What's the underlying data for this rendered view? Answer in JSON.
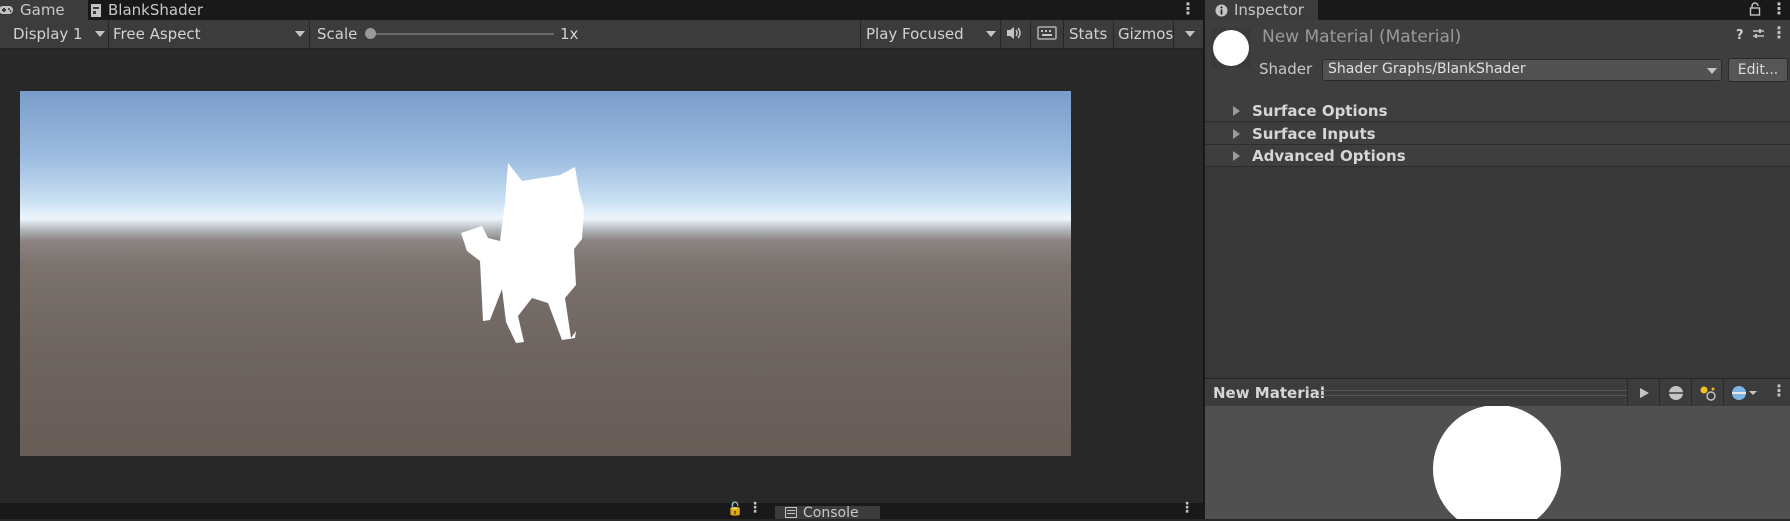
{
  "game_panel": {
    "tabs": [
      {
        "label": "Game",
        "icon": "gamepad-icon"
      },
      {
        "label": "BlankShader",
        "icon": "shader-file-icon"
      }
    ],
    "toolbar": {
      "display": "Display 1",
      "aspect": "Free Aspect",
      "scale_label": "Scale",
      "scale_value": "1x",
      "play_mode": "Play Focused",
      "stats": "Stats",
      "gizmos": "Gizmos"
    },
    "bottom_tabs": [
      {
        "label": "Console",
        "icon": "console-icon"
      }
    ]
  },
  "inspector": {
    "tab_label": "Inspector",
    "material_title": "New Material (Material)",
    "shader_label": "Shader",
    "shader_value": "Shader Graphs/BlankShader",
    "edit_button": "Edit...",
    "foldouts": [
      "Surface Options",
      "Surface Inputs",
      "Advanced Options"
    ],
    "preview_title": "New Material"
  },
  "colors": {
    "panel_bg": "#282828",
    "toolbar_bg": "#3c3c3c",
    "inspector_bg": "#383838",
    "preview_bg": "#505050",
    "sky_top": "#7a9cc9",
    "ground": "#6e6560"
  }
}
